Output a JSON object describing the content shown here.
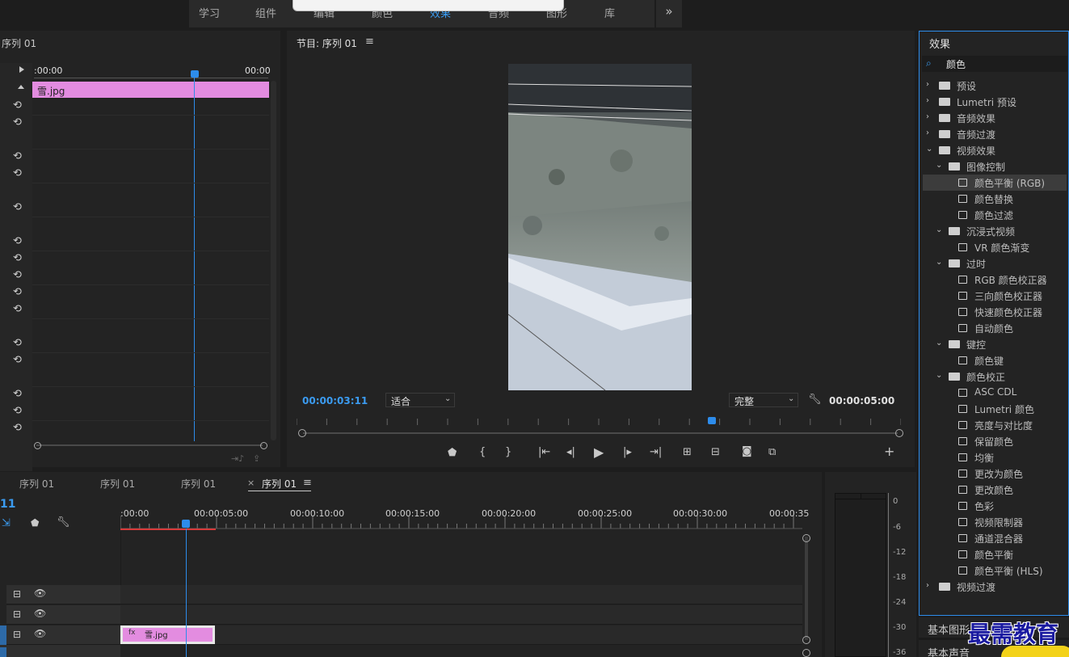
{
  "workspace_tabs": [
    "学习",
    "组件",
    "编辑",
    "颜色",
    "效果",
    "音频",
    "图形",
    "库"
  ],
  "workspace_more": "»",
  "source_panel": {
    "title": "序列 01",
    "timecode_start": ":00:00",
    "timecode_end": "00:00",
    "clip_label": "雪.jpg"
  },
  "program": {
    "title": "节目: 序列 01",
    "current_time": "00:00:03:11",
    "fit_select": "适合",
    "quality_select": "完整",
    "duration": "00:00:05:00"
  },
  "effects": {
    "title": "效果",
    "search_value": "颜色",
    "tree": [
      {
        "label": "预设",
        "type": "folder",
        "level": 0,
        "expanded": false
      },
      {
        "label": "Lumetri 预设",
        "type": "folder",
        "level": 0,
        "expanded": false
      },
      {
        "label": "音频效果",
        "type": "folder",
        "level": 0,
        "expanded": false
      },
      {
        "label": "音频过渡",
        "type": "folder",
        "level": 0,
        "expanded": false
      },
      {
        "label": "视频效果",
        "type": "folder",
        "level": 0,
        "expanded": true
      },
      {
        "label": "图像控制",
        "type": "folder",
        "level": 1,
        "expanded": true
      },
      {
        "label": "颜色平衡 (RGB)",
        "type": "effect",
        "level": 2,
        "selected": true
      },
      {
        "label": "颜色替换",
        "type": "effect",
        "level": 2
      },
      {
        "label": "颜色过滤",
        "type": "effect",
        "level": 2
      },
      {
        "label": "沉浸式视频",
        "type": "folder",
        "level": 1,
        "expanded": true
      },
      {
        "label": "VR 颜色渐变",
        "type": "effect",
        "level": 2
      },
      {
        "label": "过时",
        "type": "folder",
        "level": 1,
        "expanded": true
      },
      {
        "label": "RGB 颜色校正器",
        "type": "effect",
        "level": 2
      },
      {
        "label": "三向颜色校正器",
        "type": "effect",
        "level": 2
      },
      {
        "label": "快速颜色校正器",
        "type": "effect",
        "level": 2
      },
      {
        "label": "自动颜色",
        "type": "effect",
        "level": 2
      },
      {
        "label": "键控",
        "type": "folder",
        "level": 1,
        "expanded": true
      },
      {
        "label": "颜色键",
        "type": "effect",
        "level": 2
      },
      {
        "label": "颜色校正",
        "type": "folder",
        "level": 1,
        "expanded": true
      },
      {
        "label": "ASC CDL",
        "type": "effect",
        "level": 2
      },
      {
        "label": "Lumetri 颜色",
        "type": "effect",
        "level": 2
      },
      {
        "label": "亮度与对比度",
        "type": "effect",
        "level": 2
      },
      {
        "label": "保留颜色",
        "type": "effect",
        "level": 2
      },
      {
        "label": "均衡",
        "type": "effect",
        "level": 2
      },
      {
        "label": "更改为颜色",
        "type": "effect",
        "level": 2
      },
      {
        "label": "更改颜色",
        "type": "effect",
        "level": 2
      },
      {
        "label": "色彩",
        "type": "effect",
        "level": 2
      },
      {
        "label": "视频限制器",
        "type": "effect",
        "level": 2
      },
      {
        "label": "通道混合器",
        "type": "effect",
        "level": 2
      },
      {
        "label": "颜色平衡",
        "type": "effect",
        "level": 2
      },
      {
        "label": "颜色平衡 (HLS)",
        "type": "effect",
        "level": 2
      },
      {
        "label": "视频过渡",
        "type": "folder",
        "level": 0,
        "expanded": false
      }
    ]
  },
  "timeline": {
    "tabs": [
      "序列 01",
      "序列 01",
      "序列 01",
      "序列 01"
    ],
    "active_tab_index": 3,
    "close_glyph": "×",
    "track_number": "11",
    "ruler_labels": [
      ":00:00",
      "00:00:05:00",
      "00:00:10:00",
      "00:00:15:00",
      "00:00:20:00",
      "00:00:25:00",
      "00:00:30:00",
      "00:00:35"
    ],
    "clip_label": "雪.jpg"
  },
  "meter": {
    "db_labels": [
      "0",
      "-6",
      "-12",
      "-18",
      "-24",
      "-30",
      "-36"
    ]
  },
  "bottom_panels": [
    "基本图形",
    "基本声音"
  ],
  "watermark": "最需教育",
  "colors": {
    "accent_blue": "#2d8ceb",
    "clip_pink": "#e38ce0",
    "timecode_blue": "#3b9bf0"
  }
}
